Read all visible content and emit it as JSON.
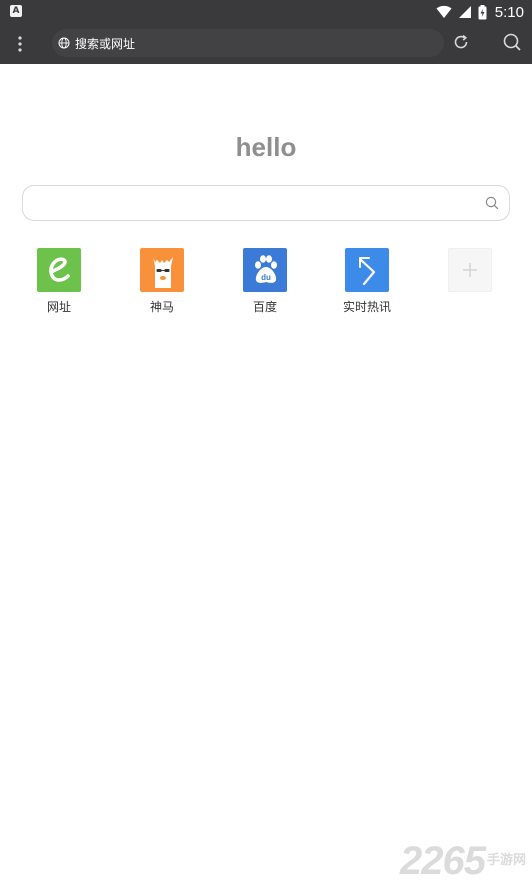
{
  "status_bar": {
    "left_badge": "A",
    "time": "5:10"
  },
  "toolbar": {
    "address_text": "搜索或网址",
    "icons": [
      "menu-dots-icon",
      "globe-icon",
      "refresh-icon",
      "search-icon"
    ]
  },
  "main": {
    "greeting": "hello",
    "search": {
      "value": "",
      "placeholder": ""
    },
    "shortcuts": [
      {
        "label": "网址",
        "icon": "e-letter-icon",
        "color": "#6cc24a"
      },
      {
        "label": "神马",
        "icon": "llama-icon",
        "color": "#f8913a"
      },
      {
        "label": "百度",
        "icon": "baidu-paw-icon",
        "color": "#3b7ad6"
      },
      {
        "label": "实时热讯",
        "icon": "lightning-arrow-icon",
        "color": "#3d8be8"
      },
      {
        "label": "",
        "icon": "plus-icon",
        "color": "#f6f6f6"
      }
    ]
  },
  "watermark": {
    "number": "2265",
    "text": "手游网"
  },
  "colors": {
    "toolbar_bg": "#3a3a3c",
    "greeting": "#8f8f8f"
  }
}
